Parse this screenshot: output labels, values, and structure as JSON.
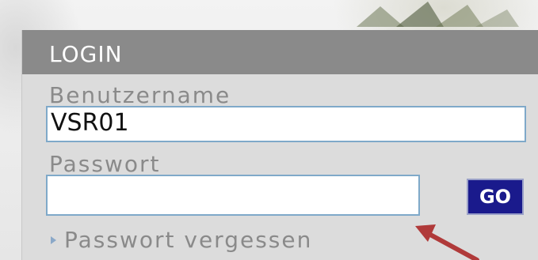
{
  "login": {
    "title": "LOGIN",
    "username_label": "Benutzername",
    "username_value": "VSR01",
    "password_label": "Passwort",
    "password_value": "",
    "go_label": "GO",
    "forgot_label": "Passwort vergessen"
  },
  "colors": {
    "header_bg": "#8a8a8a",
    "panel_bg": "#dcdcdc",
    "input_border": "#7fa9c9",
    "go_button": "#1a1a8c",
    "annotation_arrow": "#b03a3a"
  },
  "icons": [
    "bullet-arrow-icon",
    "annotation-arrow-icon"
  ]
}
